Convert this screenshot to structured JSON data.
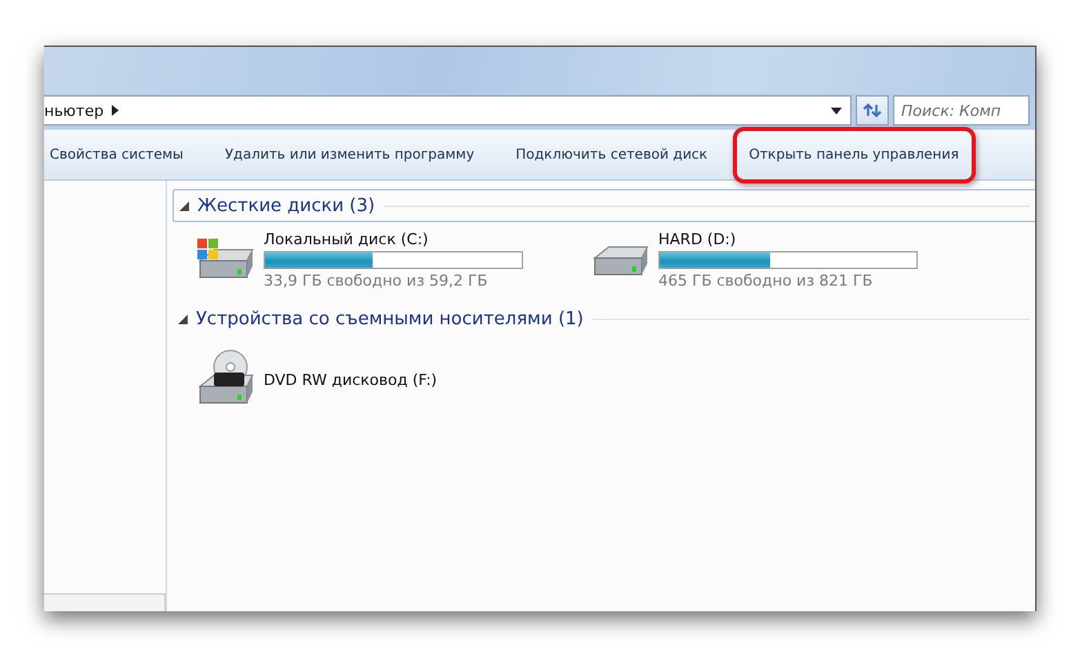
{
  "address_bar": {
    "path": "ньютер",
    "search_placeholder": "Поиск: Комп"
  },
  "toolbar": [
    {
      "label": "Свойства системы",
      "highlighted": false
    },
    {
      "label": "Удалить или изменить программу",
      "highlighted": false
    },
    {
      "label": "Подключить сетевой диск",
      "highlighted": false
    },
    {
      "label": "Открыть панель управления",
      "highlighted": true
    }
  ],
  "groups": [
    {
      "title": "Жесткие диски (3)",
      "expanded": true,
      "items": [
        {
          "kind": "system-drive",
          "name": "Локальный диск (C:)",
          "level": 0.42,
          "free": "33,9 ГБ свободно из 59,2 ГБ"
        },
        {
          "kind": "drive",
          "name": "HARD (D:)",
          "level": 0.43,
          "free": "465 ГБ свободно из 821 ГБ"
        }
      ]
    },
    {
      "title": "Устройства со съемными носителями (1)",
      "expanded": true,
      "items": [
        {
          "kind": "dvd",
          "name": "DVD RW дисковод (F:)"
        }
      ]
    }
  ]
}
